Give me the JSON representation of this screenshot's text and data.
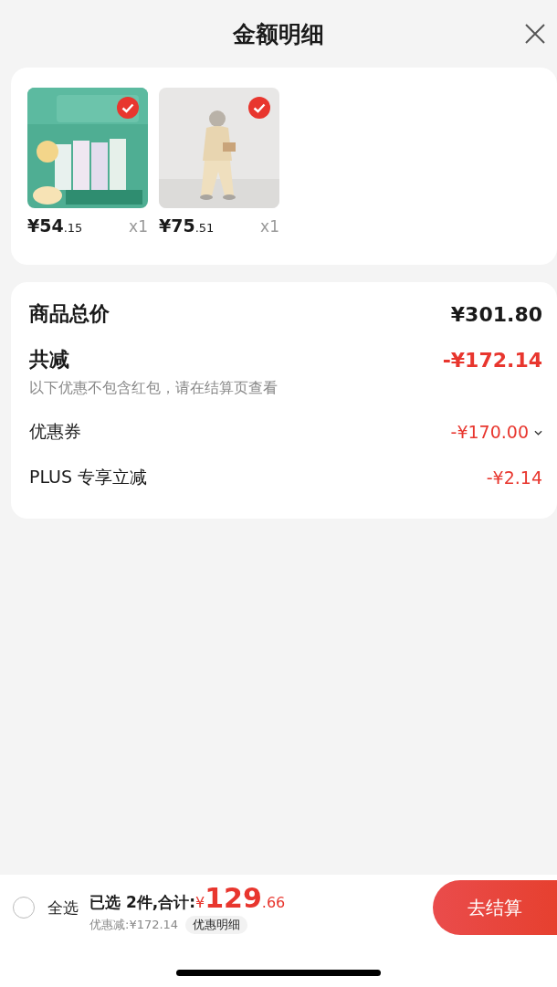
{
  "title": "金额明细",
  "products": [
    {
      "kind": "picture",
      "price_int": "¥54",
      "price_dec": ".15",
      "qty": "x1",
      "selected": true
    },
    {
      "kind": "picture",
      "price_int": "¥75",
      "price_dec": ".51",
      "qty": "x1",
      "selected": true
    }
  ],
  "summary": {
    "total_label": "商品总价",
    "total_value": "¥301.80",
    "reduce_label": "共减",
    "reduce_value": "-¥172.14",
    "reduce_note": "以下优惠不包含红包，请在结算页查看",
    "rows": [
      {
        "label": "优惠券",
        "value": "-¥170.00",
        "expandable": true
      },
      {
        "label": "PLUS 专享立减",
        "value": "-¥2.14",
        "expandable": false
      }
    ]
  },
  "bottom": {
    "select_all": {
      "label": "全选",
      "checked": false
    },
    "selected_text": "已选 2件,合计:",
    "currency": "¥",
    "total_int": "129",
    "total_dec": ".66",
    "discount": "优惠减:¥172.14",
    "detail_button": "优惠明细",
    "checkout": "去结算"
  }
}
